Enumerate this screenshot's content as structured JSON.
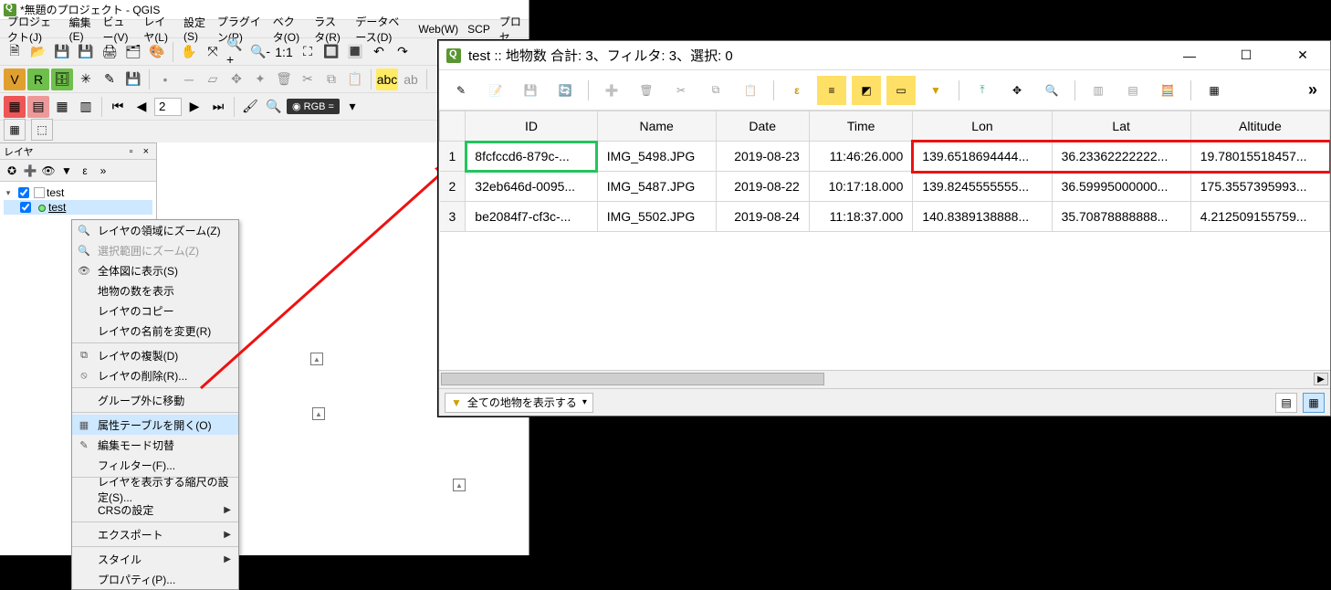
{
  "main_window": {
    "title": "*無題のプロジェクト - QGIS",
    "menubar": [
      "プロジェクト(J)",
      "編集(E)",
      "ビュー(V)",
      "レイヤ(L)",
      "設定(S)",
      "プラグイン(P)",
      "ベクタ(O)",
      "ラスタ(R)",
      "データベース(D)",
      "Web(W)",
      "SCP",
      "プロセ"
    ],
    "rgb_label": "RGB ="
  },
  "layers_panel": {
    "title": "レイヤ",
    "group": "test",
    "layer": "test"
  },
  "context_menu": {
    "items": [
      {
        "label": "レイヤの領域にズーム(Z)",
        "icon": "zoom"
      },
      {
        "label": "選択範囲にズーム(Z)",
        "icon": "zoom",
        "disabled": true
      },
      {
        "label": "全体図に表示(S)",
        "icon": "overview"
      },
      {
        "label": "地物の数を表示",
        "icon": ""
      },
      {
        "label": "レイヤのコピー",
        "icon": ""
      },
      {
        "label": "レイヤの名前を変更(R)",
        "icon": ""
      },
      {
        "sep": true
      },
      {
        "label": "レイヤの複製(D)",
        "icon": "dup"
      },
      {
        "label": "レイヤの削除(R)...",
        "icon": "del"
      },
      {
        "sep": true
      },
      {
        "label": "グループ外に移動",
        "icon": ""
      },
      {
        "sep": true
      },
      {
        "label": "属性テーブルを開く(O)",
        "icon": "table",
        "hov": true
      },
      {
        "label": "編集モード切替",
        "icon": "pencil"
      },
      {
        "label": "フィルター(F)...",
        "icon": ""
      },
      {
        "sep": true
      },
      {
        "label": "レイヤを表示する縮尺の設定(S)...",
        "icon": ""
      },
      {
        "label": "CRSの設定",
        "icon": "",
        "sub": true
      },
      {
        "sep": true
      },
      {
        "label": "エクスポート",
        "icon": "",
        "sub": true
      },
      {
        "sep": true
      },
      {
        "label": "スタイル",
        "icon": "",
        "sub": true
      },
      {
        "label": "プロパティ(P)...",
        "icon": ""
      }
    ]
  },
  "attr_window": {
    "title": "test :: 地物数 合計: 3、フィルタ: 3、選択: 0",
    "columns": [
      "ID",
      "Name",
      "Date",
      "Time",
      "Lon",
      "Lat",
      "Altitude"
    ],
    "rows": [
      {
        "n": "1",
        "ID": "8fcfccd6-879c-...",
        "Name": "IMG_5498.JPG",
        "Date": "2019-08-23",
        "Time": "11:46:26.000",
        "Lon": "139.6518694444...",
        "Lat": "36.23362222222...",
        "Altitude": "19.78015518457..."
      },
      {
        "n": "2",
        "ID": "32eb646d-0095...",
        "Name": "IMG_5487.JPG",
        "Date": "2019-08-22",
        "Time": "10:17:18.000",
        "Lon": "139.8245555555...",
        "Lat": "36.59995000000...",
        "Altitude": "175.3557395993..."
      },
      {
        "n": "3",
        "ID": "be2084f7-cf3c-...",
        "Name": "IMG_5502.JPG",
        "Date": "2019-08-24",
        "Time": "11:18:37.000",
        "Lon": "140.8389138888...",
        "Lat": "35.70878888888...",
        "Altitude": "4.212509155759..."
      }
    ],
    "footer_filter": "全ての地物を表示する"
  }
}
